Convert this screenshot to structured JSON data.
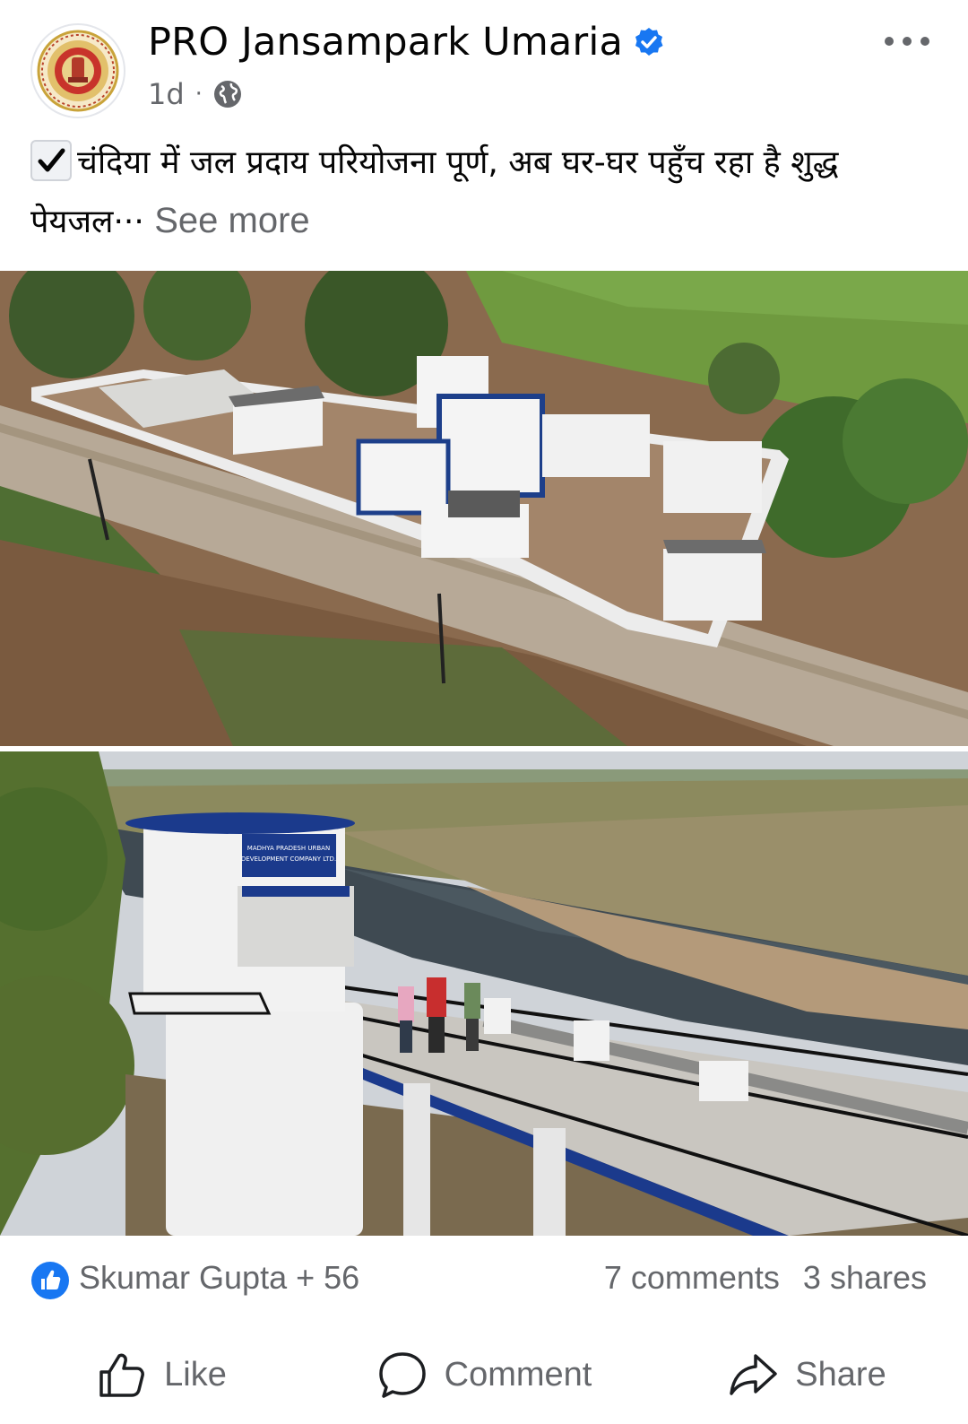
{
  "post": {
    "author": "PRO Jansampark Umaria",
    "time": "1d",
    "separator": "·",
    "audience_icon": "globe-icon",
    "caption_line": "चंदिया में जल प्रदाय परियोजना पूर्ण, अब घर-घर पहुँच रहा है शुद्ध पेयजल",
    "caption_ellipsis": "···",
    "see_more": "See more"
  },
  "photo2_sign": {
    "line1": "MADHYA PRADESH URBAN",
    "line2": "DEVELOPMENT COMPANY LTD."
  },
  "engagement": {
    "reactors": "Skumar Gupta + 56",
    "comments": "7 comments",
    "shares": "3 shares"
  },
  "actions": {
    "like": "Like",
    "comment": "Comment",
    "share": "Share"
  },
  "colors": {
    "verified_blue": "#1877f2",
    "secondary_text": "#65676b",
    "primary_text": "#050505"
  }
}
